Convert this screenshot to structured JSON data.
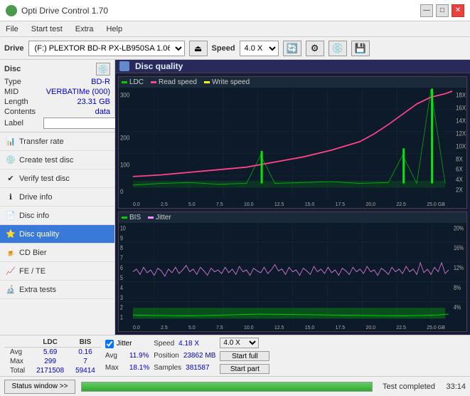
{
  "titleBar": {
    "title": "Opti Drive Control 1.70",
    "minimizeBtn": "—",
    "maximizeBtn": "□",
    "closeBtn": "✕"
  },
  "menuBar": {
    "items": [
      "File",
      "Start test",
      "Extra",
      "Help"
    ]
  },
  "toolbar": {
    "driveLabel": "Drive",
    "driveValue": "(F:) PLEXTOR BD-R  PX-LB950SA 1.06",
    "speedLabel": "Speed",
    "speedValue": "4.0 X"
  },
  "disc": {
    "label": "Disc",
    "typeLabel": "Type",
    "typeValue": "BD-R",
    "midLabel": "MID",
    "midValue": "VERBATIMe (000)",
    "lengthLabel": "Length",
    "lengthValue": "23.31 GB",
    "contentsLabel": "Contents",
    "contentsValue": "data",
    "labelLabel": "Label"
  },
  "navItems": [
    {
      "id": "transfer-rate",
      "label": "Transfer rate",
      "icon": "📊"
    },
    {
      "id": "create-test-disc",
      "label": "Create test disc",
      "icon": "💿"
    },
    {
      "id": "verify-test-disc",
      "label": "Verify test disc",
      "icon": "✔"
    },
    {
      "id": "drive-info",
      "label": "Drive info",
      "icon": "ℹ"
    },
    {
      "id": "disc-info",
      "label": "Disc info",
      "icon": "📄"
    },
    {
      "id": "disc-quality",
      "label": "Disc quality",
      "icon": "⭐",
      "active": true
    },
    {
      "id": "cd-bier",
      "label": "CD Bier",
      "icon": "🍺"
    },
    {
      "id": "fe-te",
      "label": "FE / TE",
      "icon": "📈"
    },
    {
      "id": "extra-tests",
      "label": "Extra tests",
      "icon": "🔬"
    }
  ],
  "chartHeader": {
    "title": "Disc quality"
  },
  "chart1": {
    "legend": [
      {
        "label": "LDC",
        "color": "#00cc00"
      },
      {
        "label": "Read speed",
        "color": "#ff4488"
      },
      {
        "label": "Write speed",
        "color": "#ffff00"
      }
    ],
    "yMax": 300,
    "yAxisLabels": [
      "0",
      "100",
      "200",
      "300"
    ],
    "rightAxisLabels": [
      "18X",
      "16X",
      "14X",
      "12X",
      "10X",
      "8X",
      "6X",
      "4X",
      "2X"
    ],
    "xAxisLabels": [
      "0.0",
      "2.5",
      "5.0",
      "7.5",
      "10.0",
      "12.5",
      "15.0",
      "17.5",
      "20.0",
      "22.5",
      "25.0 GB"
    ]
  },
  "chart2": {
    "legend": [
      {
        "label": "BIS",
        "color": "#00cc00"
      },
      {
        "label": "Jitter",
        "color": "#ff88ff"
      }
    ],
    "yMax": 10,
    "yAxisLabels": [
      "1",
      "2",
      "3",
      "4",
      "5",
      "6",
      "7",
      "8",
      "9",
      "10"
    ],
    "rightAxisLabels": [
      "20%",
      "16%",
      "12%",
      "8%",
      "4%"
    ],
    "xAxisLabels": [
      "0.0",
      "2.5",
      "5.0",
      "7.5",
      "10.0",
      "12.5",
      "15.0",
      "17.5",
      "20.0",
      "22.5",
      "25.0 GB"
    ]
  },
  "stats": {
    "columns": [
      "",
      "LDC",
      "BIS"
    ],
    "rows": [
      {
        "label": "Avg",
        "ldc": "5.69",
        "bis": "0.16"
      },
      {
        "label": "Max",
        "ldc": "299",
        "bis": "7"
      },
      {
        "label": "Total",
        "ldc": "2171508",
        "bis": "59414"
      }
    ],
    "jitter": {
      "checked": true,
      "label": "Jitter",
      "avg": "11.9%",
      "max": "18.1%"
    },
    "speed": {
      "speedLabel": "Speed",
      "speedValue": "4.18 X",
      "positionLabel": "Position",
      "positionValue": "23862 MB",
      "samplesLabel": "Samples",
      "samplesValue": "381587",
      "selectValue": "4.0 X"
    },
    "buttons": {
      "startFull": "Start full",
      "startPart": "Start part"
    }
  },
  "statusBar": {
    "windowBtn": "Status window >>",
    "statusText": "Test completed",
    "progress": 100,
    "time": "33:14"
  }
}
